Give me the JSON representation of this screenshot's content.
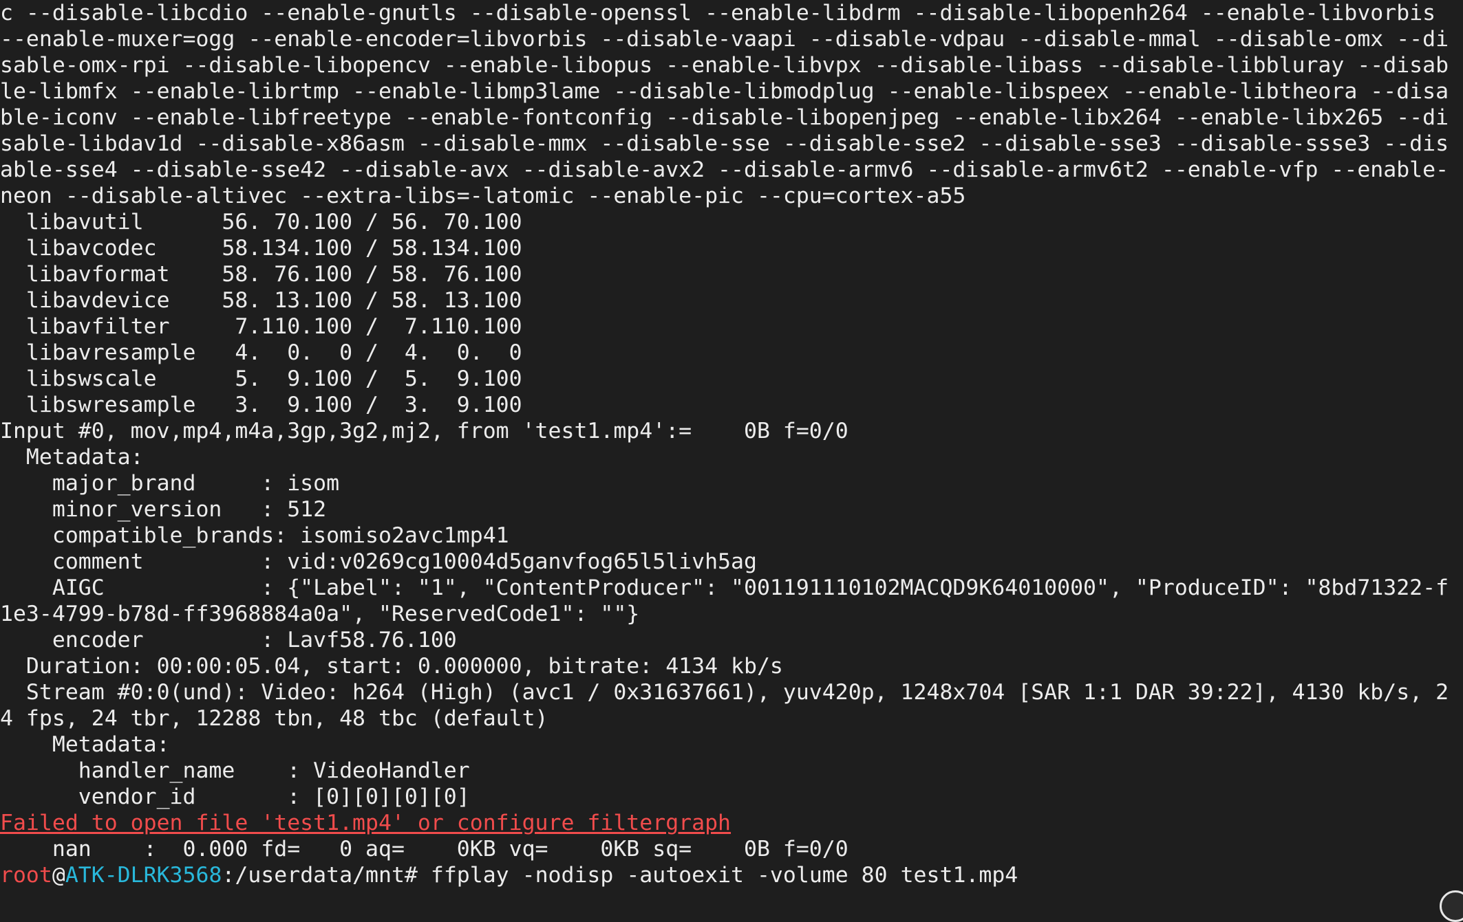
{
  "terminal": {
    "lines": [
      "c --disable-libcdio --enable-gnutls --disable-openssl --enable-libdrm --disable-libopenh264 --enable-libvorbis",
      "--enable-muxer=ogg --enable-encoder=libvorbis --disable-vaapi --disable-vdpau --disable-mmal --disable-omx --di",
      "sable-omx-rpi --disable-libopencv --enable-libopus --enable-libvpx --disable-libass --disable-libbluray --disab",
      "le-libmfx --enable-librtmp --enable-libmp3lame --disable-libmodplug --enable-libspeex --enable-libtheora --disa",
      "ble-iconv --enable-libfreetype --enable-fontconfig --disable-libopenjpeg --enable-libx264 --enable-libx265 --di",
      "sable-libdav1d --disable-x86asm --disable-mmx --disable-sse --disable-sse2 --disable-sse3 --disable-ssse3 --dis",
      "able-sse4 --disable-sse42 --disable-avx --disable-avx2 --disable-armv6 --disable-armv6t2 --enable-vfp --enable-",
      "neon --disable-altivec --extra-libs=-latomic --enable-pic --cpu=cortex-a55",
      "  libavutil      56. 70.100 / 56. 70.100",
      "  libavcodec     58.134.100 / 58.134.100",
      "  libavformat    58. 76.100 / 58. 76.100",
      "  libavdevice    58. 13.100 / 58. 13.100",
      "  libavfilter     7.110.100 /  7.110.100",
      "  libavresample   4.  0.  0 /  4.  0.  0",
      "  libswscale      5.  9.100 /  5.  9.100",
      "  libswresample   3.  9.100 /  3.  9.100",
      "Input #0, mov,mp4,m4a,3gp,3g2,mj2, from 'test1.mp4':=    0B f=0/0",
      "  Metadata:",
      "    major_brand     : isom",
      "    minor_version   : 512",
      "    compatible_brands: isomiso2avc1mp41",
      "    comment         : vid:v0269cg10004d5ganvfog65l5livh5ag",
      "    AIGC            : {\"Label\": \"1\", \"ContentProducer\": \"001191110102MACQD9K64010000\", \"ProduceID\": \"8bd71322-f",
      "1e3-4799-b78d-ff3968884a0a\", \"ReservedCode1\": \"\"}",
      "    encoder         : Lavf58.76.100",
      "  Duration: 00:00:05.04, start: 0.000000, bitrate: 4134 kb/s",
      "  Stream #0:0(und): Video: h264 (High) (avc1 / 0x31637661), yuv420p, 1248x704 [SAR 1:1 DAR 39:22], 4130 kb/s, 2",
      "4 fps, 24 tbr, 12288 tbn, 48 tbc (default)",
      "    Metadata:",
      "      handler_name    : VideoHandler",
      "      vendor_id       : [0][0][0][0]"
    ],
    "error_line": "Failed to open file 'test1.mp4' or configure filtergraph",
    "status_line": "    nan    :  0.000 fd=   0 aq=    0KB vq=    0KB sq=    0B f=0/0",
    "prompt": {
      "user": "root",
      "at": "@",
      "host": "ATK-DLRK3568",
      "path": ":/userdata/mnt#",
      "command": " ffplay -nodisp -autoexit -volume 80 test1.mp4"
    },
    "colors": {
      "background": "#1e1e1e",
      "foreground": "#ececec",
      "error": "#f14c4c",
      "prompt_user": "#f14c4c",
      "prompt_host": "#29b8db"
    }
  }
}
